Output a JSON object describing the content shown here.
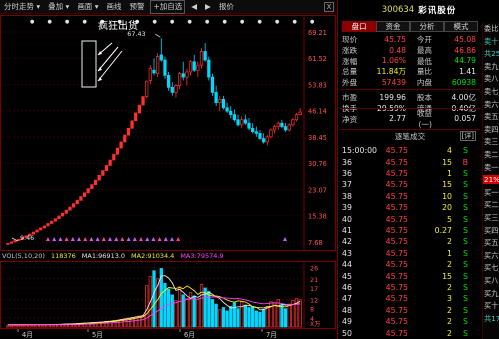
{
  "toolbar": {
    "items": [
      {
        "name": "intraday-menu",
        "label": "分时走势 ▾"
      },
      {
        "name": "overlay-menu",
        "label": "叠加 ▾"
      },
      {
        "name": "draw-line-menu",
        "label": "画面 ▾"
      },
      {
        "name": "draw-tool",
        "label": "画线"
      },
      {
        "name": "alert",
        "label": "预警"
      },
      {
        "name": "add-watchlist",
        "label": "+加自选"
      },
      {
        "name": "page-prev",
        "label": "◀"
      },
      {
        "name": "page-next",
        "label": "▶"
      },
      {
        "name": "quote-tool",
        "label": "报价"
      }
    ],
    "close_label": "X"
  },
  "annotation": {
    "label": "疯狂出货",
    "high_value": "67.43",
    "low_value": "9.46"
  },
  "price_axis": {
    "labels": [
      "69.21",
      "61.52",
      "53.83",
      "46.14",
      "38.45",
      "30.76",
      "23.07",
      "15.38",
      "7.68"
    ]
  },
  "volume": {
    "header_label": "VOL(5,10,20)",
    "vol_value": "118376",
    "ma1": "MA1:96913.0",
    "ma2": "MA2:91034.4",
    "ma3": "MA3:79574.9",
    "axis_labels": [
      "26",
      "21",
      "17",
      "12",
      "8",
      "4"
    ],
    "axis_unit": "X万"
  },
  "time_axis": {
    "labels": [
      "4月",
      "5月",
      "6月",
      "7月"
    ]
  },
  "stock": {
    "code": "300634",
    "name": "彩讯股份"
  },
  "panel_tabs": [
    "盘口",
    "资金",
    "分析",
    "模式"
  ],
  "quote": [
    {
      "l": "现价",
      "v": "45.75",
      "vc": "red",
      "l2": "今开",
      "v2": "45.08",
      "v2c": "red"
    },
    {
      "l": "涨跌",
      "v": "0.48",
      "vc": "red",
      "l2": "最高",
      "v2": "46.86",
      "v2c": "red"
    },
    {
      "l": "涨幅",
      "v": "1.06%",
      "vc": "red",
      "l2": "最低",
      "v2": "44.79",
      "v2c": "green"
    },
    {
      "l": "总量",
      "v": "11.84万",
      "vc": "yellow",
      "l2": "量比",
      "v2": "1.41",
      "v2c": "white"
    },
    {
      "l": "外盘",
      "v": "57439",
      "vc": "red",
      "l2": "内盘",
      "v2": "60938",
      "v2c": "green"
    },
    {
      "l": "市盈",
      "v": "199.96",
      "vc": "white",
      "l2": "股本",
      "v2": "4.00亿",
      "v2c": "white"
    },
    {
      "l": "换手",
      "v": "29.59%",
      "vc": "white",
      "l2": "流通",
      "v2": "0.40亿",
      "v2c": "white"
    },
    {
      "l": "净资",
      "v": "2.77",
      "vc": "white",
      "l2": "收益(一)",
      "v2": "0.057",
      "v2c": "white"
    }
  ],
  "deals": {
    "header": "逐笔成交",
    "detail_label": "[详]",
    "rows": [
      {
        "t": "15:00:00",
        "p": "45.75",
        "v": "4",
        "s": "S",
        "sc": "green"
      },
      {
        "t": "36",
        "p": "45.75",
        "v": "15",
        "s": "B",
        "sc": "red"
      },
      {
        "t": "36",
        "p": "45.75",
        "v": "1",
        "s": "S",
        "sc": "green"
      },
      {
        "t": "37",
        "p": "45.75",
        "v": "15",
        "s": "S",
        "sc": "green"
      },
      {
        "t": "38",
        "p": "45.75",
        "v": "10",
        "s": "S",
        "sc": "green"
      },
      {
        "t": "39",
        "p": "45.75",
        "v": "20",
        "s": "S",
        "sc": "green"
      },
      {
        "t": "40",
        "p": "45.75",
        "v": "5",
        "s": "S",
        "sc": "green"
      },
      {
        "t": "41",
        "p": "45.75",
        "v": "0.27",
        "s": "S",
        "sc": "green"
      },
      {
        "t": "42",
        "p": "45.75",
        "v": "2",
        "s": "S",
        "sc": "green"
      },
      {
        "t": "43",
        "p": "45.75",
        "v": "1",
        "s": "S",
        "sc": "green"
      },
      {
        "t": "44",
        "p": "45.75",
        "v": "2",
        "s": "S",
        "sc": "green"
      },
      {
        "t": "45",
        "p": "45.75",
        "v": "15",
        "s": "S",
        "sc": "green"
      },
      {
        "t": "46",
        "p": "45.75",
        "v": "2",
        "s": "S",
        "sc": "green"
      },
      {
        "t": "47",
        "p": "45.75",
        "v": "3",
        "s": "S",
        "sc": "green"
      },
      {
        "t": "48",
        "p": "45.75",
        "v": "2",
        "s": "S",
        "sc": "green"
      },
      {
        "t": "49",
        "p": "45.75",
        "v": "2",
        "s": "S",
        "sc": "green"
      },
      {
        "t": "50",
        "p": "45.75",
        "v": "2",
        "s": "S",
        "sc": "green"
      }
    ]
  },
  "side_strip": {
    "items": [
      {
        "label": "委比",
        "style": ""
      },
      {
        "label": "卖十",
        "style": "teal"
      },
      {
        "label": "共25",
        "style": "teal"
      },
      {
        "label": "卖九",
        "style": ""
      },
      {
        "label": "卖八",
        "style": ""
      },
      {
        "label": "卖七",
        "style": ""
      },
      {
        "label": "卖六",
        "style": ""
      },
      {
        "label": "卖五",
        "style": ""
      },
      {
        "label": "卖四",
        "style": ""
      },
      {
        "label": "卖三",
        "style": ""
      },
      {
        "label": "卖二",
        "style": ""
      },
      {
        "label": "卖一",
        "style": ""
      },
      {
        "label": "21%",
        "style": "hot"
      },
      {
        "label": "买一",
        "style": ""
      },
      {
        "label": "买二",
        "style": ""
      },
      {
        "label": "买三",
        "style": ""
      },
      {
        "label": "买四",
        "style": ""
      },
      {
        "label": "买五",
        "style": ""
      },
      {
        "label": "买六",
        "style": ""
      },
      {
        "label": "买七",
        "style": ""
      },
      {
        "label": "买八",
        "style": ""
      },
      {
        "label": "买九",
        "style": ""
      },
      {
        "label": "买十",
        "style": ""
      },
      {
        "label": "共174",
        "style": "teal"
      }
    ]
  },
  "colors": {
    "up": "#ff3030",
    "down": "#00d8ff",
    "ma1": "#e8e8e8",
    "ma2": "#f0f020",
    "ma3": "#ff40ff",
    "grid": "#7a0000"
  },
  "chart_data": {
    "type": "candlestick",
    "price_range": [
      7.68,
      69.21
    ],
    "candles": [
      [
        7.0,
        7.3,
        6.9,
        7.3
      ],
      [
        7.3,
        7.7,
        7.2,
        7.7
      ],
      [
        7.7,
        8.1,
        7.6,
        8.1
      ],
      [
        8.1,
        8.5,
        8.0,
        8.5
      ],
      [
        8.5,
        9.0,
        8.4,
        9.0
      ],
      [
        9.0,
        9.5,
        8.9,
        9.5
      ],
      [
        9.5,
        10.0,
        9.4,
        10.0
      ],
      [
        10.0,
        10.6,
        9.9,
        10.6
      ],
      [
        10.6,
        11.2,
        10.5,
        11.2
      ],
      [
        11.2,
        11.8,
        11.1,
        11.8
      ],
      [
        11.8,
        12.4,
        11.7,
        12.4
      ],
      [
        12.4,
        13.1,
        12.3,
        13.1
      ],
      [
        13.1,
        13.8,
        13.0,
        13.8
      ],
      [
        13.8,
        14.5,
        13.7,
        14.5
      ],
      [
        14.5,
        15.3,
        14.4,
        15.3
      ],
      [
        15.3,
        16.1,
        15.2,
        16.1
      ],
      [
        16.1,
        17.0,
        16.0,
        17.0
      ],
      [
        17.0,
        17.9,
        16.9,
        17.9
      ],
      [
        17.9,
        18.9,
        17.8,
        18.9
      ],
      [
        18.9,
        19.9,
        18.8,
        19.9
      ],
      [
        19.9,
        21.0,
        19.8,
        21.0
      ],
      [
        21.0,
        22.1,
        20.9,
        22.1
      ],
      [
        22.1,
        23.3,
        22.0,
        23.3
      ],
      [
        23.3,
        24.5,
        23.2,
        24.5
      ],
      [
        24.5,
        25.8,
        24.4,
        25.8
      ],
      [
        25.8,
        27.2,
        25.7,
        27.2
      ],
      [
        27.2,
        28.6,
        27.1,
        28.6
      ],
      [
        28.6,
        30.1,
        28.5,
        30.1
      ],
      [
        30.1,
        31.7,
        30.0,
        31.7
      ],
      [
        31.7,
        33.4,
        31.6,
        33.4
      ],
      [
        33.4,
        35.2,
        33.3,
        35.2
      ],
      [
        35.2,
        37.0,
        35.1,
        37.0
      ],
      [
        37.0,
        39.0,
        36.9,
        39.0
      ],
      [
        39.0,
        41.0,
        38.9,
        41.0
      ],
      [
        41.0,
        43.2,
        40.9,
        43.2
      ],
      [
        43.2,
        45.5,
        43.1,
        45.5
      ],
      [
        45.5,
        47.8,
        45.4,
        47.8
      ],
      [
        47.8,
        50.3,
        47.7,
        50.3
      ],
      [
        50.3,
        55.0,
        49.8,
        54.8
      ],
      [
        55.0,
        59.5,
        54.0,
        58.6
      ],
      [
        58.0,
        61.5,
        56.5,
        57.2
      ],
      [
        57.0,
        63.0,
        56.0,
        62.0
      ],
      [
        62.5,
        67.4,
        60.5,
        61.0
      ],
      [
        61.0,
        62.0,
        55.5,
        56.5
      ],
      [
        56.5,
        57.5,
        52.0,
        53.0
      ],
      [
        53.0,
        54.5,
        50.5,
        51.5
      ],
      [
        51.5,
        54.0,
        50.0,
        53.5
      ],
      [
        53.5,
        57.5,
        52.5,
        57.0
      ],
      [
        57.0,
        60.5,
        55.0,
        56.0
      ],
      [
        56.0,
        58.5,
        53.5,
        57.5
      ],
      [
        57.5,
        61.0,
        56.5,
        60.5
      ],
      [
        60.5,
        62.5,
        57.5,
        58.0
      ],
      [
        58.0,
        60.5,
        56.0,
        59.5
      ],
      [
        59.5,
        64.5,
        58.5,
        63.5
      ],
      [
        63.5,
        66.0,
        60.5,
        61.0
      ],
      [
        61.0,
        62.0,
        55.0,
        56.0
      ],
      [
        56.0,
        57.0,
        50.5,
        51.5
      ],
      [
        51.5,
        53.5,
        47.5,
        48.5
      ],
      [
        48.5,
        50.5,
        46.0,
        49.5
      ],
      [
        49.5,
        50.5,
        46.5,
        47.0
      ],
      [
        47.0,
        48.5,
        45.5,
        46.0
      ],
      [
        46.0,
        47.5,
        44.0,
        45.0
      ],
      [
        45.0,
        46.5,
        43.0,
        43.5
      ],
      [
        43.5,
        45.0,
        41.5,
        42.0
      ],
      [
        42.0,
        44.5,
        41.0,
        43.5
      ],
      [
        43.5,
        45.0,
        42.0,
        42.5
      ],
      [
        42.5,
        44.0,
        40.5,
        41.0
      ],
      [
        41.0,
        42.5,
        39.5,
        40.0
      ],
      [
        40.0,
        41.5,
        38.5,
        39.5
      ],
      [
        39.5,
        40.5,
        37.5,
        38.0
      ],
      [
        38.0,
        39.5,
        36.5,
        37.0
      ],
      [
        37.0,
        39.0,
        36.0,
        38.5
      ],
      [
        38.5,
        41.0,
        38.0,
        40.5
      ],
      [
        40.5,
        42.0,
        39.5,
        41.5
      ],
      [
        41.5,
        43.0,
        40.5,
        42.5
      ],
      [
        42.5,
        43.5,
        41.0,
        41.5
      ],
      [
        41.5,
        42.5,
        40.0,
        40.5
      ],
      [
        40.5,
        42.5,
        40.0,
        42.0
      ],
      [
        42.0,
        44.0,
        41.5,
        43.5
      ],
      [
        43.5,
        45.5,
        43.0,
        45.0
      ],
      [
        45.0,
        46.9,
        44.8,
        45.75
      ]
    ],
    "volumes": [
      0.5,
      0.5,
      0.6,
      0.6,
      0.7,
      0.7,
      0.8,
      0.8,
      0.9,
      0.9,
      1.0,
      1.0,
      1.1,
      1.1,
      1.2,
      1.2,
      1.3,
      1.4,
      1.4,
      1.5,
      1.6,
      1.7,
      1.8,
      1.9,
      2.0,
      2.1,
      2.2,
      2.4,
      2.6,
      2.8,
      3.0,
      3.3,
      3.6,
      3.9,
      4.2,
      4.5,
      4.8,
      5.1,
      18.0,
      22.0,
      24.5,
      21.0,
      25.5,
      19.0,
      16.5,
      14.0,
      11.5,
      17.5,
      14.0,
      12.5,
      15.0,
      13.5,
      12.0,
      18.5,
      17.0,
      15.5,
      12.0,
      10.0,
      7.5,
      8.5,
      7.0,
      9.0,
      10.5,
      8.0,
      11.0,
      9.5,
      8.5,
      9.0,
      7.0,
      6.5,
      7.5,
      9.0,
      11.0,
      10.5,
      12.0,
      9.5,
      8.0,
      10.0,
      11.5,
      12.5,
      11.8
    ],
    "ma_lines": {
      "ma1": [
        1,
        1,
        1,
        1,
        1,
        1,
        1,
        1,
        1,
        1,
        1,
        1,
        1,
        1,
        1.1,
        1.2,
        1.3,
        1.3,
        1.4,
        1.5,
        1.6,
        1.7,
        1.8,
        1.9,
        2.0,
        2.1,
        2.2,
        2.4,
        2.5,
        2.7,
        2.9,
        3.2,
        3.5,
        3.7,
        4.0,
        4.3,
        4.6,
        4.9,
        7.5,
        10.9,
        14.9,
        18.1,
        22.2,
        22.4,
        21.3,
        19.2,
        16.0,
        16.4,
        15.1,
        13.6,
        12.4,
        13.5,
        12.9,
        14.0,
        14.3,
        15.1,
        14.2,
        13.1,
        12.4,
        10.7,
        9.4,
        8.3,
        8.4,
        8.8,
        8.8,
        9.5,
        9.4,
        8.9,
        8.6,
        7.5,
        7.6,
        8.3,
        8.8,
        9.5,
        9.2,
        9.8,
        9.6,
        9.7,
        9.7,
        10.4,
        11.2
      ],
      "ma2": [
        1,
        1,
        1,
        1,
        1,
        1,
        1,
        1,
        1,
        1,
        1,
        1,
        1,
        1,
        1,
        1,
        1,
        1.1,
        1.2,
        1.3,
        1.4,
        1.5,
        1.6,
        1.7,
        1.8,
        1.9,
        2.0,
        2.1,
        2.3,
        2.4,
        2.6,
        2.8,
        3.0,
        3.2,
        3.5,
        3.8,
        4.1,
        4.4,
        5.7,
        7.6,
        9.8,
        11.9,
        14.5,
        15.9,
        17.2,
        17.0,
        16.8,
        17.2,
        16.7,
        17.9,
        17.0,
        15.8,
        14.2,
        15.2,
        14.9,
        14.0,
        13.6,
        13.5,
        13.2,
        12.6,
        11.7,
        11.2,
        10.8,
        11.4,
        11.2,
        10.9,
        10.0,
        8.7,
        8.5,
        8.4,
        8.3,
        8.8,
        9.0,
        9.3,
        9.0,
        8.9,
        8.8,
        9.3,
        9.8,
        10.0,
        10.1
      ],
      "ma3": [
        1,
        1,
        1,
        1,
        1,
        1,
        1,
        1,
        1,
        1,
        1,
        1,
        1,
        1,
        1,
        1,
        1,
        1,
        1,
        1,
        1.1,
        1.2,
        1.3,
        1.3,
        1.4,
        1.5,
        1.6,
        1.7,
        1.8,
        1.9,
        2.0,
        2.1,
        2.3,
        2.4,
        2.6,
        2.8,
        3.0,
        3.2,
        3.9,
        4.9,
        6.0,
        7.0,
        8.2,
        9.0,
        9.8,
        10.2,
        10.6,
        11.1,
        11.4,
        12.0,
        12.2,
        12.3,
        12.1,
        12.6,
        12.8,
        13.0,
        13.0,
        13.0,
        12.9,
        12.7,
        12.6,
        12.5,
        12.3,
        12.4,
        12.1,
        11.8,
        11.4,
        10.9,
        10.6,
        10.3,
        10.1,
        10.2,
        10.4,
        10.6,
        10.4,
        10.2,
        9.9,
        9.8,
        9.9,
        9.9,
        10.0
      ]
    },
    "volume_range": [
      0,
      27
    ]
  }
}
